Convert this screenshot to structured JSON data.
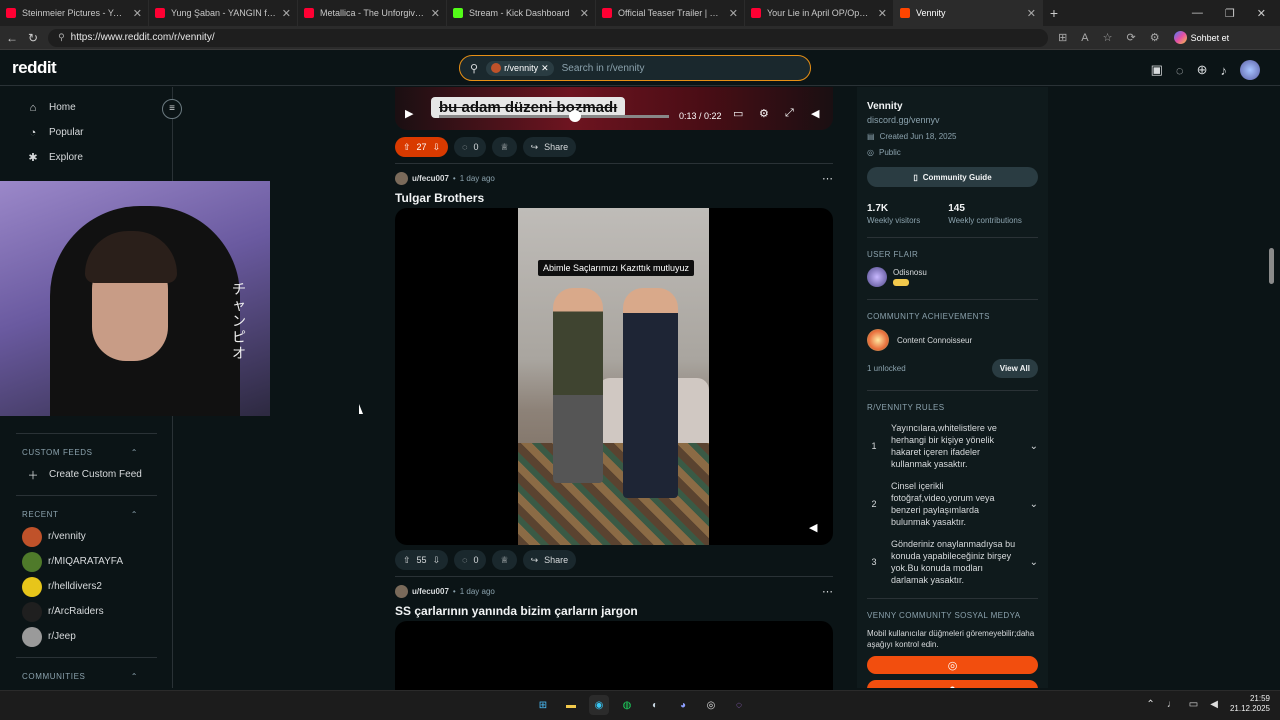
{
  "browser": {
    "tabs": [
      {
        "title": "Steinmeier Pictures - YouTube",
        "color": "#ff0033"
      },
      {
        "title": "Yung Şaban - YANGIN ft. Neocast",
        "color": "#ff0033"
      },
      {
        "title": "Metallica - The Unforgiven (Officia",
        "color": "#ff0033"
      },
      {
        "title": "Stream - Kick Dashboard",
        "color": "#53fc18"
      },
      {
        "title": "Official Teaser Trailer | BLEACH: Th",
        "color": "#ff0033"
      },
      {
        "title": "Your Lie in April OP/Opening Then",
        "color": "#ff0033"
      },
      {
        "title": "Vennity",
        "color": "#ff4500"
      }
    ],
    "url": "https://www.reddit.com/r/vennity/",
    "chat_label": "Sohbet et"
  },
  "header": {
    "logo": "reddit",
    "search_chip": "r/vennity",
    "search_placeholder": "Search in r/vennity"
  },
  "sidebar": {
    "nav": [
      {
        "label": "Home",
        "icon": "home-icon"
      },
      {
        "label": "Popular",
        "icon": "popular-icon"
      },
      {
        "label": "Explore",
        "icon": "explore-icon"
      }
    ],
    "custom_feeds_heading": "CUSTOM FEEDS",
    "create_feed": "Create Custom Feed",
    "recent_heading": "RECENT",
    "recent": [
      {
        "label": "r/vennity",
        "color": "#c0522a"
      },
      {
        "label": "r/MIQARATAYFA",
        "color": "#4f7a2a"
      },
      {
        "label": "r/helldivers2",
        "color": "#e7c51a"
      },
      {
        "label": "r/ArcRaiders",
        "color": "#1f1f1f"
      },
      {
        "label": "r/Jeep",
        "color": "#9a9a9a"
      }
    ],
    "communities_heading": "COMMUNITIES"
  },
  "video_top": {
    "caption": "bu adam düzeni bozmadı",
    "time": "0:13 / 0:22",
    "progress": 0.59
  },
  "post1_actions": {
    "votes": "27",
    "comments": "0",
    "share": "Share"
  },
  "post2": {
    "user": "u/fecu007",
    "age": "1 day ago",
    "title": "Tulgar Brothers",
    "subtitle": "Abimle Saçlarımızı Kazıttık mutluyuz",
    "votes": "55",
    "comments": "0",
    "share": "Share"
  },
  "post3": {
    "user": "u/fecu007",
    "age": "1 day ago",
    "title": "SS çarlarının yanında bizim çarların jargon"
  },
  "community": {
    "name": "Vennity",
    "link": "discord.gg/vennyv",
    "created": "Created Jun 18, 2025",
    "visibility": "Public",
    "guide_button": "Community Guide",
    "visitors": "1.7K",
    "visitors_label": "Weekly visitors",
    "contributions": "145",
    "contributions_label": "Weekly contributions",
    "flair_heading": "USER FLAIR",
    "flair_name": "Odisnosu",
    "achievements_heading": "COMMUNITY ACHIEVEMENTS",
    "achievement": "Content Connoisseur",
    "unlocked": "1 unlocked",
    "view_all": "View All",
    "rules_heading": "R/VENNITY RULES",
    "rules": [
      {
        "num": "1",
        "text": "Yayıncılara,whitelistlere ve herhangi bir kişiye yönelik hakaret içeren ifadeler kullanmak yasaktır."
      },
      {
        "num": "2",
        "text": "Cinsel içerikli fotoğraf,video,yorum veya benzeri paylaşımlarda bulunmak yasaktır."
      },
      {
        "num": "3",
        "text": "Gönderiniz onaylanmadıysa bu konuda yapabileceğiniz birşey yok.Bu konuda modları darlamak yasaktır."
      }
    ],
    "social_heading": "VENNY COMMUNITY SOSYAL MEDYA",
    "social_desc": "Mobil kullanıcılar düğmeleri göremeyebilir;daha aşağıyı kontrol edin."
  },
  "taskbar": {
    "time": "21:59",
    "date": "21.12.2025"
  }
}
